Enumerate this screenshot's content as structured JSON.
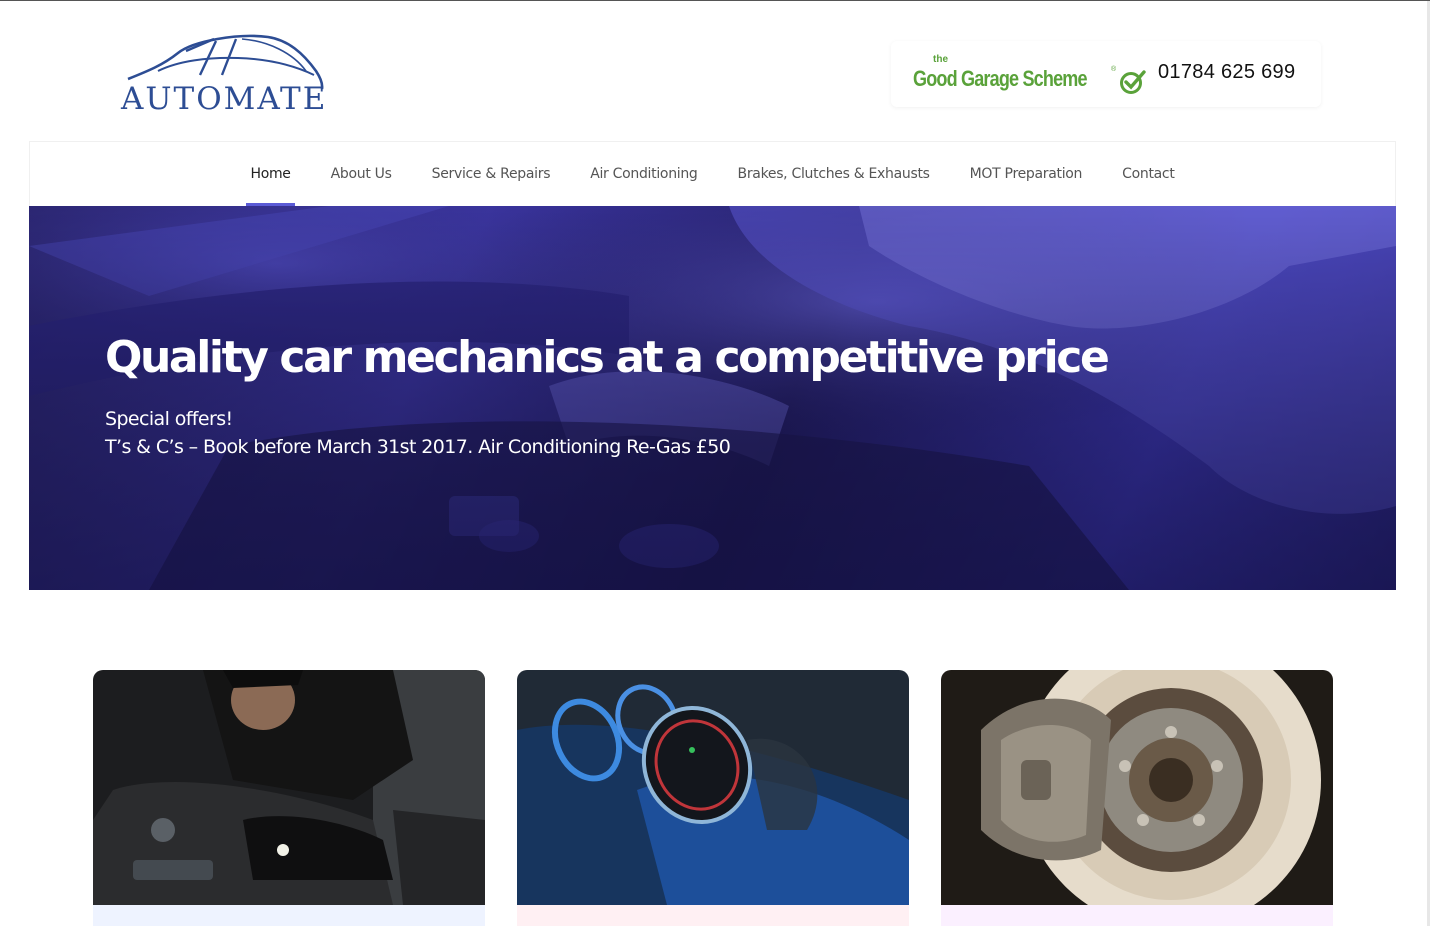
{
  "header": {
    "logo_text": "AUTOMATE",
    "badge": {
      "the": "the",
      "name": "Good Garage Scheme",
      "registered": "®"
    },
    "phone": "01784 625 699"
  },
  "nav": {
    "items": [
      {
        "label": "Home",
        "active": true
      },
      {
        "label": "About Us",
        "active": false
      },
      {
        "label": "Service & Repairs",
        "active": false
      },
      {
        "label": "Air Conditioning",
        "active": false
      },
      {
        "label": "Brakes, Clutches & Exhausts",
        "active": false
      },
      {
        "label": "MOT Preparation",
        "active": false
      },
      {
        "label": "Contact",
        "active": false
      }
    ],
    "active_color": "#5b5bd6"
  },
  "hero": {
    "title": "Quality car mechanics at a competitive price",
    "line1": "Special offers!",
    "line2": "T’s & C’s – Book before March 31st 2017. Air Conditioning Re-Gas £50",
    "overlay_color": "#3a34a0"
  },
  "cards": [
    {
      "image": "mechanic-working-engine",
      "footer_color": "#eef3ff"
    },
    {
      "image": "car-dashboard-gauge",
      "footer_color": "#fff0f3"
    },
    {
      "image": "brake-disc-caliper",
      "footer_color": "#fbf0ff"
    }
  ]
}
